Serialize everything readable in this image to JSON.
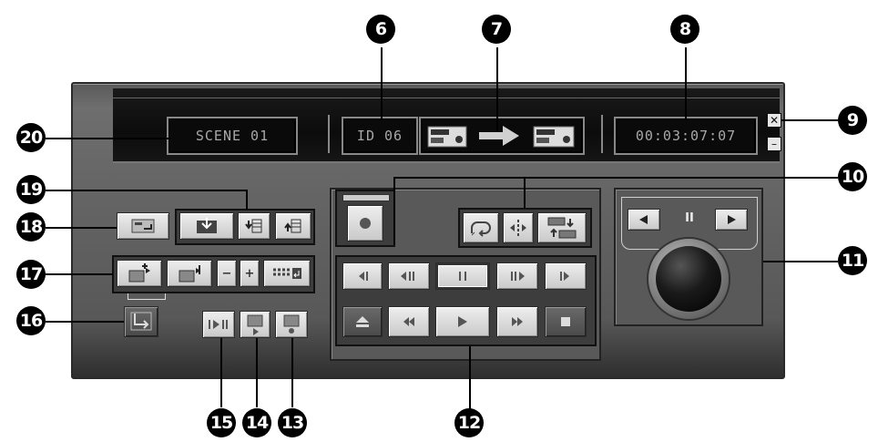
{
  "callouts": {
    "c6": "6",
    "c7": "7",
    "c8": "8",
    "c9": "9",
    "c10": "10",
    "c11": "11",
    "c12": "12",
    "c13": "13",
    "c14": "14",
    "c15": "15",
    "c16": "16",
    "c17": "17",
    "c18": "18",
    "c19": "19",
    "c20": "20"
  },
  "display": {
    "scene": "SCENE 01",
    "id": "ID 06",
    "timecode": "00:03:07:07"
  },
  "window": {
    "close_glyph": "✕",
    "minimize_glyph": "–"
  },
  "jog": {
    "pause_glyph": "II"
  },
  "icons": {
    "mark_in": "import-scene-icon",
    "add_scene": "add-scene-icon",
    "insert_before": "insert-before-icon",
    "insert_after": "insert-after-icon",
    "set_in": "set-in-point-icon",
    "set_out": "set-out-point-icon",
    "record": "record-icon",
    "transfer_arrow": "dubbing-arrow-icon"
  },
  "colors": {
    "body": "#646464",
    "lcd_text": "#a8a8a8",
    "lcd_bg": "#0a0a0a"
  }
}
